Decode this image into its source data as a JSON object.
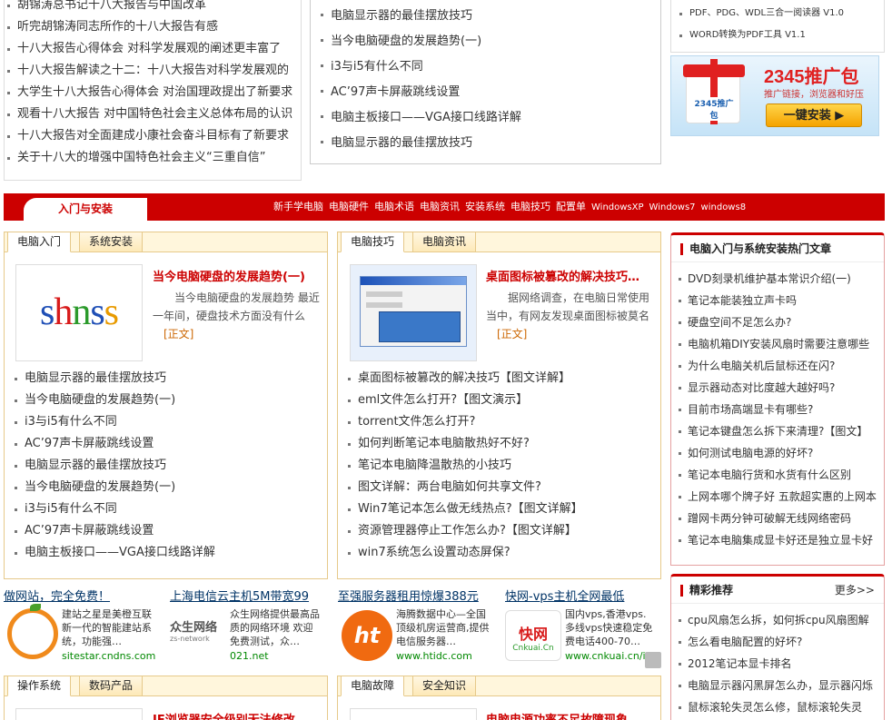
{
  "top": {
    "left_list": [
      "胡锦涛总书记十八大报告与中国改革",
      "听完胡锦涛同志所作的十八大报告有感",
      "十八大报告心得体会 对科学发展观的阐述更丰富了",
      "十八大报告解读之十二：十八大报告对科学发展观的",
      "大学生十八大报告心得体会 对治国理政提出了新要求",
      "观看十八大报告 对中国特色社会主义总体布局的认识",
      "十八大报告对全面建成小康社会奋斗目标有了新要求",
      "关于十八大的增强中国特色社会主义“三重自信”"
    ],
    "mid_list": [
      "电脑显示器的最佳摆放技巧",
      "当今电脑硬盘的发展趋势(一)",
      "i3与i5有什么不同",
      "AC’97声卡屏蔽跳线设置",
      "电脑主板接口——VGA接口线路详解",
      "电脑显示器的最佳摆放技巧"
    ],
    "right_list": [
      "PDF、PDG、WDL三合一阅读器 V1.0",
      "WORD转换为PDF工具 V1.1"
    ],
    "banner": {
      "title": "2345推广包",
      "sub": "推广链接，浏览器和好压",
      "button": "一键安装 ▶",
      "box_text": "2345推广包"
    }
  },
  "nav": {
    "tab": "入门与安装",
    "links": [
      "新手学电脑",
      "电脑硬件",
      "电脑术语",
      "电脑资讯",
      "安装系统",
      "电脑技巧",
      "配置单",
      "WindowsXP",
      "Windows7",
      "windows8"
    ]
  },
  "box1": {
    "tabs": [
      "电脑入门",
      "系统安装"
    ],
    "title": "当今电脑硬盘的发展趋势(一)",
    "desc": "当今电脑硬盘的发展趋势 最近一年间，硬盘技术方面没有什么",
    "more": "[正文]",
    "logo": "shnss",
    "list": [
      "电脑显示器的最佳摆放技巧",
      "当今电脑硬盘的发展趋势(一)",
      "i3与i5有什么不同",
      "AC’97声卡屏蔽跳线设置",
      "电脑显示器的最佳摆放技巧",
      "当今电脑硬盘的发展趋势(一)",
      "i3与i5有什么不同",
      "AC’97声卡屏蔽跳线设置",
      "电脑主板接口——VGA接口线路详解"
    ]
  },
  "box2": {
    "tabs": [
      "电脑技巧",
      "电脑资讯"
    ],
    "title": "桌面图标被篡改的解决技巧…",
    "desc": "据网络调查，在电脑日常使用当中，有网友发现桌面图标被莫名",
    "more": "[正文]",
    "list": [
      "桌面图标被篡改的解决技巧【图文详解】",
      "eml文件怎么打开?【图文演示】",
      "torrent文件怎么打开?",
      "如何判断笔记本电脑散热好不好?",
      "笔记本电脑降温散热的小技巧",
      "图文详解：两台电脑如何共享文件?",
      "Win7笔记本怎么做无线热点?【图文详解】",
      "资源管理器停止工作怎么办?【图文详解】",
      "win7系统怎么设置动态屏保?"
    ]
  },
  "side1": {
    "title": "电脑入门与系统安装热门文章",
    "list": [
      "DVD刻录机维护基本常识介绍(一)",
      "笔记本能装独立声卡吗",
      "硬盘空间不足怎么办?",
      "电脑机箱DIY安装风扇时需要注意哪些",
      "为什么电脑关机后鼠标还在闪?",
      "显示器动态对比度越大越好吗?",
      "目前市场高端显卡有哪些?",
      "笔记本键盘怎么拆下来清理?【图文】",
      "如何测试电脑电源的好坏?",
      "笔记本电脑行货和水货有什么区别",
      "上网本哪个牌子好 五款超实惠的上网本",
      "蹭网卡两分钟可破解无线网络密码",
      "笔记本电脑集成显卡好还是独立显卡好"
    ]
  },
  "side2": {
    "title": "精彩推荐",
    "more": "更多>>",
    "list": [
      "cpu风扇怎么拆，如何拆cpu风扇图解",
      "怎么看电脑配置的好坏?",
      "2012笔记本显卡排名",
      "电脑显示器闪黑屏怎么办，显示器闪烁",
      "鼠标滚轮失灵怎么修，鼠标滚轮失灵"
    ]
  },
  "ads": [
    {
      "title": "做网站，完全免费！",
      "desc": "建站之星是美橙互联新一代的智能建站系统，功能强…",
      "url": "sitestar.cndns.com"
    },
    {
      "title": "上海电信云主机5M带宽99",
      "desc": "众生网络提供最高品质的网络环境 欢迎免费测试，众…",
      "url": "021.net",
      "logo": "众生网络",
      "logo_sub": "zs-network"
    },
    {
      "title": "至强服务器租用惊爆388元",
      "desc": "海腾数据中心—全国顶级机房运营商,提供电信服务器…",
      "url": "www.htidc.com"
    },
    {
      "title": "快网-vps主机全网最低",
      "desc": "国内vps,香港vps.多线vps快速稳定免费电话400-70…",
      "url": "www.cnkuai.cn/idc",
      "logo": "快网",
      "logo_sub": "Cnkuai.Cn"
    }
  ],
  "box3": {
    "tabs": [
      "操作系统",
      "数码产品"
    ],
    "title": "IE浏览器安全级别无法修改…"
  },
  "box4": {
    "tabs": [
      "电脑故障",
      "安全知识"
    ],
    "title": "电脑电源功率不足故障现象…"
  },
  "colors": {
    "red": "#cc0000",
    "tab_border": "#e6c98a",
    "feature_title": "#c00"
  }
}
